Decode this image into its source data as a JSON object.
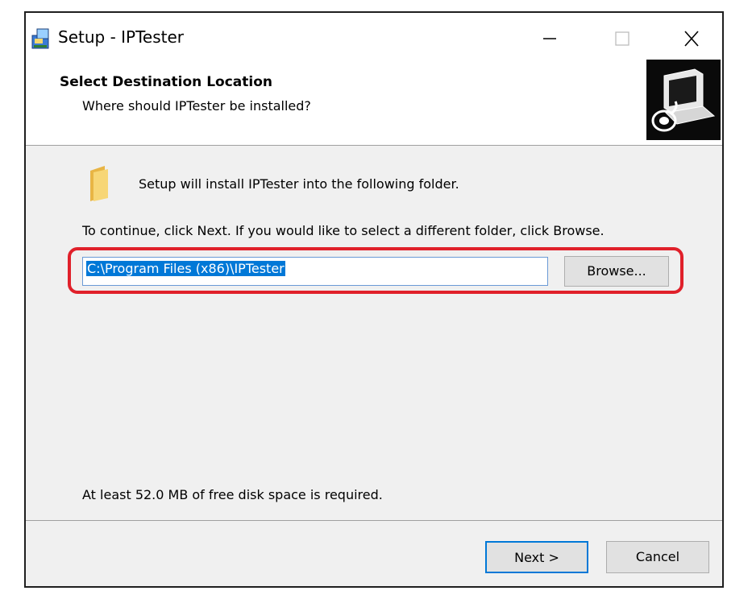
{
  "window": {
    "title": "Setup - IPTester",
    "controls": [
      "minimize-icon",
      "maximize-icon",
      "close-icon"
    ]
  },
  "header": {
    "title": "Select Destination Location",
    "subtitle": "Where should IPTester be installed?"
  },
  "body": {
    "intro_text": "Setup will install IPTester into the following folder.",
    "instruction_text": "To continue, click Next. If you would like to select a different folder, click Browse.",
    "install_path": "C:\\Program Files (x86)\\IPTester",
    "browse_label": "Browse...",
    "disk_space_text": "At least 52.0 MB of free disk space is required."
  },
  "footer": {
    "next_label": "Next >",
    "cancel_label": "Cancel"
  },
  "colors": {
    "highlight": "#e0202a",
    "selection": "#0078d7",
    "window_background": "#f0f0f0"
  }
}
